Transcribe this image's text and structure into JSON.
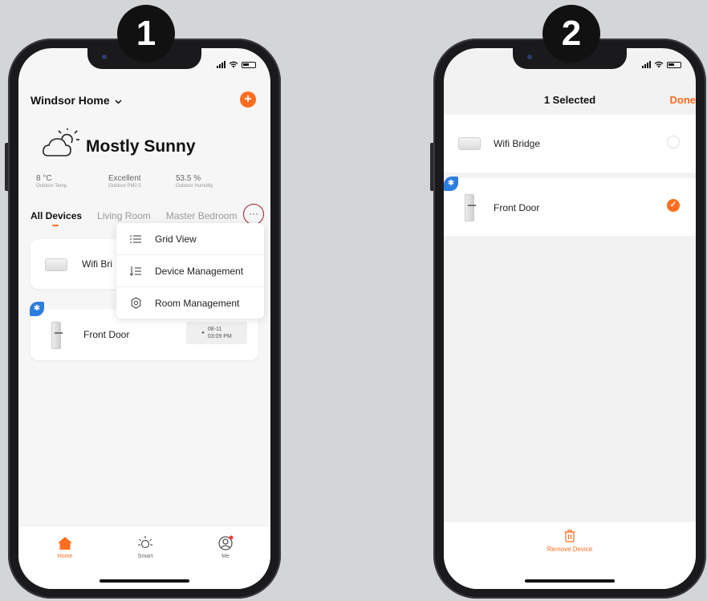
{
  "steps": {
    "one": "1",
    "two": "2"
  },
  "phone1": {
    "home_title": "Windsor Home",
    "add_label": "+",
    "weather": "Mostly Sunny",
    "stats": [
      {
        "value": "8 °C",
        "label": "Outdoor Temp."
      },
      {
        "value": "Excellent",
        "label": "Outdoor PM2.5"
      },
      {
        "value": "53.5 %",
        "label": "Outdoor Humidity"
      }
    ],
    "tabs": [
      "All Devices",
      "Living Room",
      "Master Bedroom"
    ],
    "more_label": "···",
    "menu": [
      "Grid View",
      "Device Management",
      "Room Management"
    ],
    "devices": {
      "bridge": "Wifi Bri",
      "door": "Front Door",
      "door_date": "08-11",
      "door_time": "03:09 PM"
    },
    "tabbar": [
      "Home",
      "Smart",
      "Me"
    ]
  },
  "phone2": {
    "title": "1 Selected",
    "done": "Done",
    "devices": [
      "Wifi Bridge",
      "Front Door"
    ],
    "remove": "Remove Device"
  },
  "colors": {
    "accent": "#ff6d1f",
    "bluetooth": "#2d7de0",
    "highlight_ring": "#9a1f2e"
  }
}
